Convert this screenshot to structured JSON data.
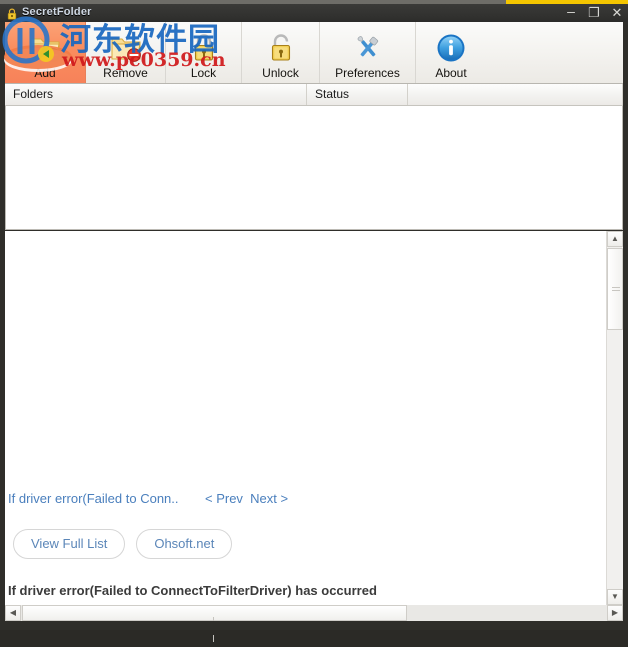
{
  "window": {
    "title": "SecretFolder",
    "controls": {
      "minimize": "–",
      "maximize": "❐",
      "close": "✕"
    },
    "accent_yellow": "#f5c600",
    "frame_color": "#2f2e2a"
  },
  "toolbar": {
    "items": [
      {
        "label": "Add",
        "icon": "folder-add-icon",
        "active": true
      },
      {
        "label": "Remove",
        "icon": "folder-remove-icon",
        "active": false
      },
      {
        "label": "Lock",
        "icon": "padlock-closed-icon",
        "active": false
      },
      {
        "label": "Unlock",
        "icon": "padlock-open-icon",
        "active": false
      },
      {
        "label": "Preferences",
        "icon": "tools-icon",
        "active": false
      },
      {
        "label": "About",
        "icon": "info-icon",
        "active": false
      }
    ],
    "active_highlight": "#f7825a"
  },
  "list": {
    "columns": [
      "Folders",
      "Status",
      ""
    ],
    "rows": []
  },
  "lower_pane": {
    "error_link": "If driver error(Failed to Conn..",
    "prev_label": "< Prev",
    "next_label": "Next >",
    "buttons": [
      {
        "label": "View Full List"
      },
      {
        "label": "Ohsoft.net"
      }
    ],
    "error_message": "If driver error(Failed to ConnectToFilterDriver) has occurred",
    "link_color": "#4a7fbd"
  },
  "scrollbars": {
    "vertical": {
      "up": "▲",
      "down": "▼"
    },
    "horizontal": {
      "left": "◀",
      "right": "▶"
    }
  },
  "watermark": {
    "chinese": "河东软件园",
    "url": "www.pc0359.cn",
    "chinese_color": "#1867c0",
    "url_color": "#d0191c"
  }
}
